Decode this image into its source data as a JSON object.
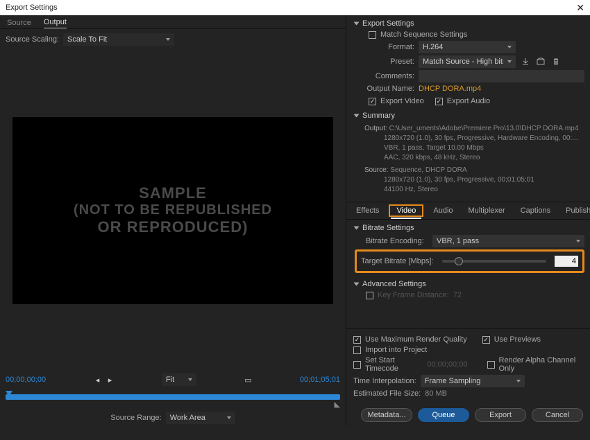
{
  "window": {
    "title": "Export Settings"
  },
  "top_tabs": {
    "source": "Source",
    "output": "Output"
  },
  "source_scaling": {
    "label": "Source Scaling:",
    "value": "Scale To Fit"
  },
  "preview": {
    "line1": "SAMPLE",
    "line2": "(NOT TO BE REPUBLISHED",
    "line3": "OR REPRODUCED)"
  },
  "timecode_start": "00;00;00;00",
  "timecode_end": "00;01;05;01",
  "fit_dropdown": "Fit",
  "source_range": {
    "label": "Source Range:",
    "value": "Work Area"
  },
  "export_settings": {
    "header": "Export Settings",
    "match_sequence": "Match Sequence Settings",
    "format_label": "Format:",
    "format_value": "H.264",
    "preset_label": "Preset:",
    "preset_value": "Match Source - High bitrate",
    "comments_label": "Comments:",
    "output_name_label": "Output Name:",
    "output_name_value": "DHCP DORA.mp4",
    "export_video": "Export Video",
    "export_audio": "Export Audio"
  },
  "summary": {
    "header": "Summary",
    "output_label": "Output:",
    "output_lines": "C:\\User_uments\\Adobe\\Premiere Pro\\13.0\\DHCP DORA.mp4\n1280x720 (1.0), 30 fps, Progressive, Hardware Encoding, 00:...\nVBR, 1 pass, Target 10.00 Mbps\nAAC, 320 kbps, 48 kHz, Stereo",
    "source_label": "Source:",
    "source_lines": "Sequence, DHCP DORA\n1280x720 (1.0), 30 fps, Progressive, 00;01;05;01\n44100 Hz, Stereo"
  },
  "mid_tabs": {
    "effects": "Effects",
    "video": "Video",
    "audio": "Audio",
    "multiplexer": "Multiplexer",
    "captions": "Captions",
    "publish": "Publish"
  },
  "bitrate": {
    "header": "Bitrate Settings",
    "encoding_label": "Bitrate Encoding:",
    "encoding_value": "VBR, 1 pass",
    "target_label": "Target Bitrate [Mbps]:",
    "target_value": "4"
  },
  "advanced": {
    "header": "Advanced Settings",
    "kfd_label": "Key Frame Distance:",
    "kfd_value": "72"
  },
  "bottom": {
    "use_max": "Use Maximum Render Quality",
    "use_previews": "Use Previews",
    "import_project": "Import into Project",
    "set_tc": "Set Start Timecode",
    "tc_value": "00;00;00;00",
    "render_alpha": "Render Alpha Channel Only",
    "time_interp_label": "Time Interpolation:",
    "time_interp_value": "Frame Sampling",
    "est_size_label": "Estimated File Size:",
    "est_size_value": "80 MB"
  },
  "buttons": {
    "metadata": "Metadata...",
    "queue": "Queue",
    "export": "Export",
    "cancel": "Cancel"
  }
}
